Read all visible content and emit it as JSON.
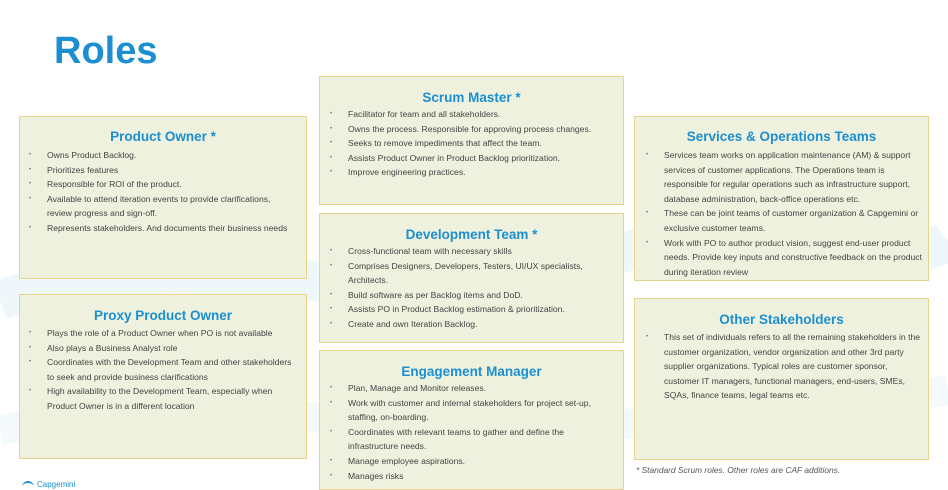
{
  "page": {
    "title": "Roles"
  },
  "cards": {
    "product_owner": {
      "title": "Product Owner *",
      "items": [
        "Owns Product Backlog.",
        "Prioritizes features",
        "Responsible for ROI  of the product.",
        "Available to attend iteration events to provide clarifications, review progress and sign-off.",
        "Represents stakeholders. And documents their business needs"
      ]
    },
    "proxy_product_owner": {
      "title": "Proxy Product Owner",
      "items": [
        "Plays the role of a Product Owner when PO is not available",
        "Also plays a Business Analyst role",
        "Coordinates with the Development Team and other stakeholders to seek and provide business clarifications",
        "High availability to the Development Team, especially when Product Owner is in a different location"
      ]
    },
    "scrum_master": {
      "title": "Scrum Master *",
      "items": [
        "Facilitator for team and all stakeholders.",
        "Owns the process. Responsible for approving process changes.",
        "Seeks to remove impediments that affect the team.",
        "Assists Product Owner in Product Backlog prioritization.",
        "Improve engineering practices."
      ]
    },
    "development_team": {
      "title": "Development Team *",
      "items": [
        "Cross-functional team with necessary skills",
        "Comprises Designers, Developers, Testers, UI/UX specialists, Architects.",
        "Build software as per Backlog items and DoD.",
        "Assists PO in Product Backlog estimation & prioritization.",
        "Create and own Iteration Backlog."
      ]
    },
    "engagement_manager": {
      "title": "Engagement Manager",
      "items": [
        "Plan, Manage and Monitor releases.",
        "Work with customer and internal stakeholders for project set-up, staffing, on-boarding.",
        "Coordinates with relevant teams to gather and define the infrastructure needs.",
        "Manage employee aspirations.",
        "Manages risks"
      ]
    },
    "services_operations": {
      "title": "Services & Operations Teams",
      "items": [
        "Services team works on application maintenance  (AM) & support services of customer applications. The Operations team is responsible for regular operations such as infrastructure support, database administration, back-office operations etc.",
        "These can be joint teams of customer organization & Capgemini or exclusive customer teams.",
        "Work with PO to author product vision, suggest end-user product needs. Provide key inputs and constructive feedback on the product during iteration review"
      ]
    },
    "other_stakeholders": {
      "title": "Other Stakeholders",
      "items": [
        "This set of individuals refers to all the remaining stakeholders in the customer organization, vendor organization and other 3rd party supplier organizations. Typical roles are customer sponsor, customer IT managers, functional managers, end-users, SMEs, SQAs, finance teams, legal teams etc."
      ]
    }
  },
  "footnote": "*  Standard Scrum roles. Other roles are CAF additions.",
  "logo": {
    "text": "Capgemini"
  },
  "colors": {
    "accent": "#1b8fd1",
    "card_bg": "#eef1dd",
    "card_border": "#e8d58a"
  }
}
